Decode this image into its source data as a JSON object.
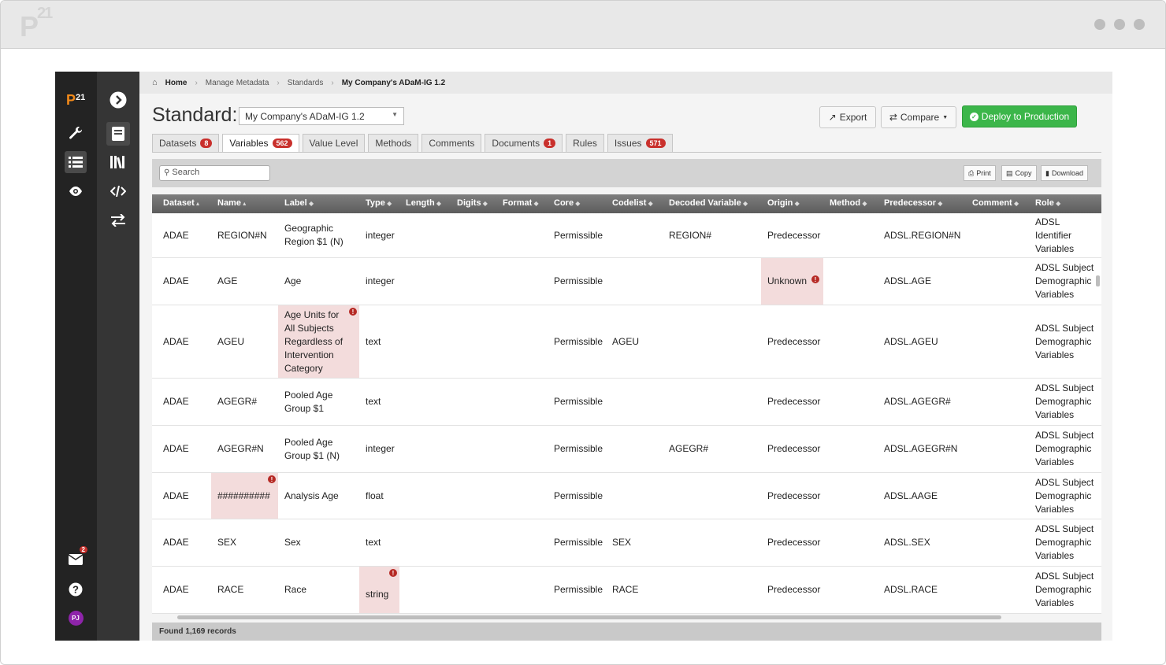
{
  "app": {
    "logo_mark": "P",
    "logo_num": "21"
  },
  "breadcrumb": {
    "home": "Home",
    "manage": "Manage Metadata",
    "standards": "Standards",
    "current": "My Company's ADaM-IG 1.2"
  },
  "header": {
    "title": "Standard:",
    "selected_standard": "My Company's ADaM-IG 1.2",
    "export_label": "Export",
    "compare_label": "Compare",
    "deploy_label": "Deploy to Production"
  },
  "tabs": [
    {
      "label": "Datasets",
      "badge": "8"
    },
    {
      "label": "Variables",
      "badge": "562"
    },
    {
      "label": "Value Level",
      "badge": ""
    },
    {
      "label": "Methods",
      "badge": ""
    },
    {
      "label": "Comments",
      "badge": ""
    },
    {
      "label": "Documents",
      "badge": "1"
    },
    {
      "label": "Rules",
      "badge": ""
    },
    {
      "label": "Issues",
      "badge": "571"
    }
  ],
  "toolbar": {
    "search_placeholder": "Search",
    "print_label": "Print",
    "copy_label": "Copy",
    "download_label": "Download"
  },
  "table": {
    "columns": [
      "Dataset",
      "Name",
      "Label",
      "Type",
      "Length",
      "Digits",
      "Format",
      "Core",
      "Codelist",
      "Decoded Variable",
      "Origin",
      "Method",
      "Predecessor",
      "Comment",
      "Role"
    ],
    "rows": [
      {
        "dataset": "ADAE",
        "name": "REGION#N",
        "label": "Geographic Region $1 (N)",
        "type": "integer",
        "core": "Permissible",
        "codelist": "",
        "decoded": "REGION#",
        "origin": "Predecessor",
        "predecessor": "ADSL.REGION#N",
        "role": "ADSL Identifier Variables"
      },
      {
        "dataset": "ADAE",
        "name": "AGE",
        "label": "Age",
        "type": "integer",
        "core": "Permissible",
        "codelist": "",
        "decoded": "",
        "origin": "Unknown",
        "predecessor": "ADSL.AGE",
        "role": "ADSL Subject Demographic Variables"
      },
      {
        "dataset": "ADAE",
        "name": "AGEU",
        "label": "Age Units for All Subjects Regardless of Intervention Category",
        "type": "text",
        "core": "Permissible",
        "codelist": "AGEU",
        "decoded": "",
        "origin": "Predecessor",
        "predecessor": "ADSL.AGEU",
        "role": "ADSL Subject Demographic Variables"
      },
      {
        "dataset": "ADAE",
        "name": "AGEGR#",
        "label": "Pooled Age Group $1",
        "type": "text",
        "core": "Permissible",
        "codelist": "",
        "decoded": "",
        "origin": "Predecessor",
        "predecessor": "ADSL.AGEGR#",
        "role": "ADSL Subject Demographic Variables"
      },
      {
        "dataset": "ADAE",
        "name": "AGEGR#N",
        "label": "Pooled Age Group $1 (N)",
        "type": "integer",
        "core": "Permissible",
        "codelist": "",
        "decoded": "AGEGR#",
        "origin": "Predecessor",
        "predecessor": "ADSL.AGEGR#N",
        "role": "ADSL Subject Demographic Variables"
      },
      {
        "dataset": "ADAE",
        "name": "##########",
        "label": "Analysis Age",
        "type": "float",
        "core": "Permissible",
        "codelist": "",
        "decoded": "",
        "origin": "Predecessor",
        "predecessor": "ADSL.AAGE",
        "role": "ADSL Subject Demographic Variables"
      },
      {
        "dataset": "ADAE",
        "name": "SEX",
        "label": "Sex",
        "type": "text",
        "core": "Permissible",
        "codelist": "SEX",
        "decoded": "",
        "origin": "Predecessor",
        "predecessor": "ADSL.SEX",
        "role": "ADSL Subject Demographic Variables"
      },
      {
        "dataset": "ADAE",
        "name": "RACE",
        "label": "Race",
        "type": "string",
        "core": "Permissible",
        "codelist": "RACE",
        "decoded": "",
        "origin": "Predecessor",
        "predecessor": "ADSL.RACE",
        "role": "ADSL Subject Demographic Variables"
      }
    ]
  },
  "footer": {
    "records": "Found 1,169 records"
  },
  "sidebar": {
    "mail_badge": "2",
    "avatar": "PJ"
  }
}
